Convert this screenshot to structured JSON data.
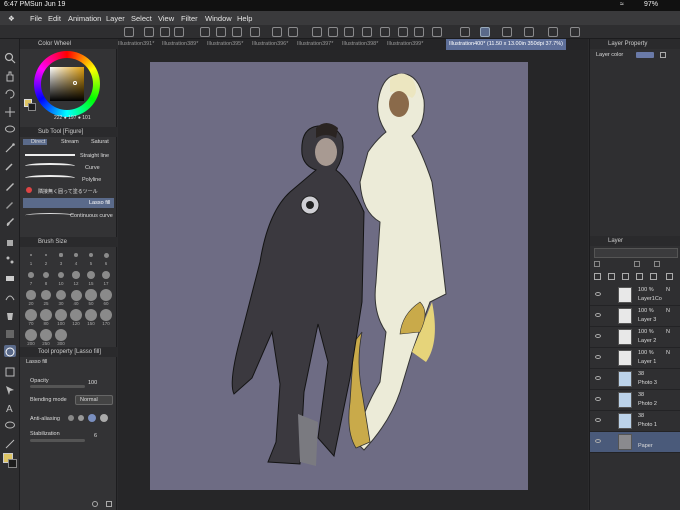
{
  "status": {
    "time": "6:47 PM",
    "date": "Sun Jun 19",
    "battery": "97%"
  },
  "menu": [
    "File",
    "Edit",
    "Animation",
    "Layer",
    "Select",
    "View",
    "Filter",
    "Window",
    "Help"
  ],
  "tabs": [
    {
      "label": "Illustration391*",
      "active": false
    },
    {
      "label": "Illustration389*",
      "active": false
    },
    {
      "label": "Illustration395*",
      "active": false
    },
    {
      "label": "Illustration396*",
      "active": false
    },
    {
      "label": "Illustration397*",
      "active": false
    },
    {
      "label": "Illustration398*",
      "active": false
    },
    {
      "label": "Illustration399*",
      "active": false
    },
    {
      "label": "Illustration400* (11.50 x 13.00in 350dpi 37.7%)",
      "active": true
    }
  ],
  "color_wheel": {
    "title": "Color Wheel",
    "rgb": "222 ● 197 ● 101",
    "main_color": "#dec565",
    "sub_color": "#1c1c1c"
  },
  "sub_tool": {
    "title": "Sub Tool [Figure]",
    "tabs": [
      "Direct",
      "Stream",
      "Saturat"
    ],
    "items": [
      "Straight line",
      "Curve",
      "Polyline",
      "隣接無く囲って塗るツール",
      "Lasso fill",
      "Continuous curve"
    ],
    "selected": "Lasso fill"
  },
  "brush_size": {
    "title": "Brush Size",
    "sizes": [
      "1",
      "2",
      "3",
      "4",
      "5",
      "6",
      "7",
      "8",
      "10",
      "12",
      "15",
      "17",
      "20",
      "25",
      "30",
      "40",
      "50",
      "60",
      "70",
      "80",
      "100",
      "120",
      "150",
      "170",
      "200",
      "250",
      "300"
    ]
  },
  "tool_property": {
    "title": "Tool property [Lasso fill]",
    "subtitle": "Lasso fill",
    "opacity_label": "Opacity",
    "opacity_value": "100",
    "blending_label": "Blending mode",
    "blending_value": "Normal",
    "antialias_label": "Anti-aliasing",
    "stabilization_label": "Stabilization",
    "stabilization_value": "6"
  },
  "layer_property": {
    "title": "Layer Property",
    "layer_color_label": "Layer color"
  },
  "layer_panel": {
    "title": "Layer",
    "layers": [
      {
        "pct": "100 %",
        "blend": "N",
        "name": "Layer1Co",
        "selected": false
      },
      {
        "pct": "100 %",
        "blend": "N",
        "name": "Layer 3",
        "selected": false
      },
      {
        "pct": "100 %",
        "blend": "N",
        "name": "Layer 2",
        "selected": false
      },
      {
        "pct": "100 %",
        "blend": "N",
        "name": "Layer 1",
        "selected": false
      },
      {
        "pct": "38",
        "blend": "",
        "name": "Photo 3",
        "selected": false
      },
      {
        "pct": "38",
        "blend": "",
        "name": "Photo 2",
        "selected": false
      },
      {
        "pct": "38",
        "blend": "",
        "name": "Photo 1",
        "selected": false
      },
      {
        "pct": "",
        "blend": "",
        "name": "Paper",
        "selected": true
      }
    ]
  },
  "colors": {
    "accent": "#5d6e98",
    "canvas": "#6e6c84",
    "wheel_highlight": "#dec565"
  }
}
